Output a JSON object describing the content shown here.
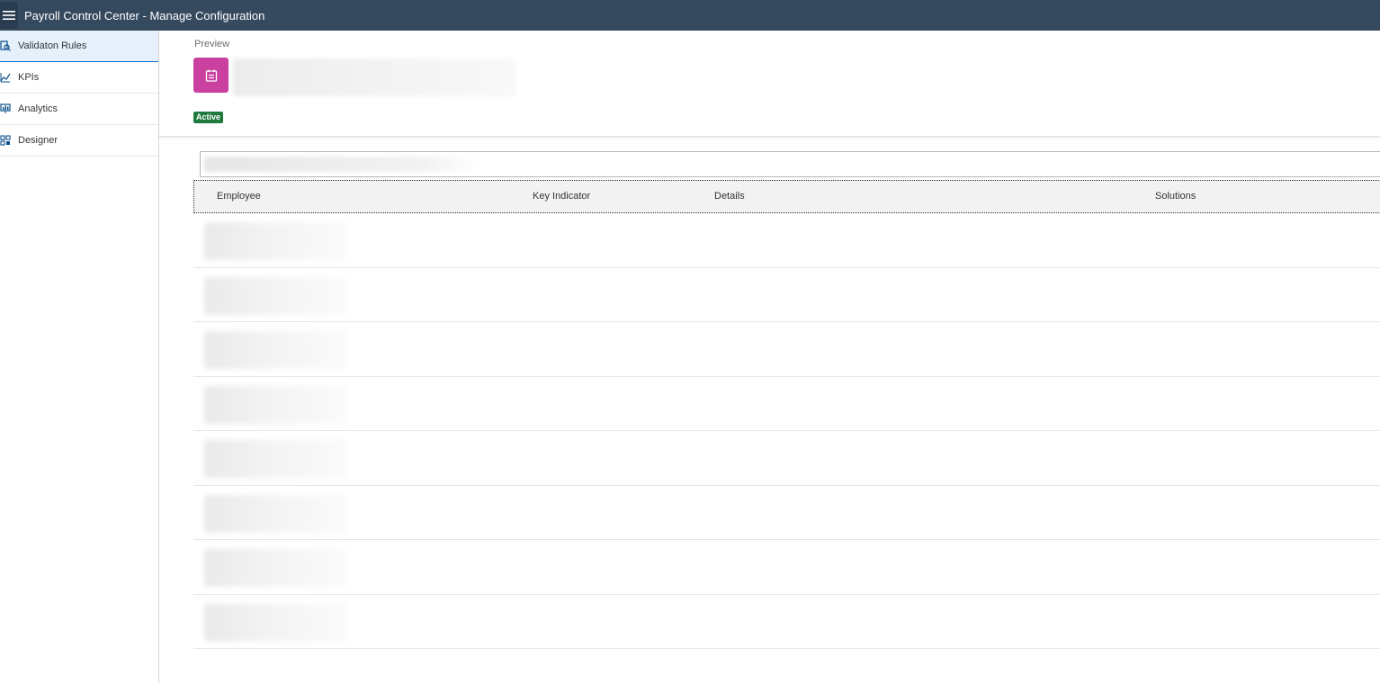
{
  "shell": {
    "title": "Payroll Control Center - Manage Configuration",
    "menu_icon": "hamburger-icon"
  },
  "sidebar": {
    "items": [
      {
        "label": "Validaton Rules",
        "icon": "validation-rules-icon",
        "selected": true
      },
      {
        "label": "KPIs",
        "icon": "kpi-chart-icon",
        "selected": false
      },
      {
        "label": "Analytics",
        "icon": "analytics-icon",
        "selected": false
      },
      {
        "label": "Designer",
        "icon": "designer-icon",
        "selected": false
      }
    ]
  },
  "header": {
    "preview_label": "Preview",
    "object_icon": "calendar-list-icon",
    "status": "Active"
  },
  "table": {
    "columns": [
      "Employee",
      "Key Indicator",
      "Details",
      "Solutions"
    ]
  },
  "colors": {
    "shell_bg": "#354a5f",
    "avatar_bg": "#c9409e",
    "status_bg": "#1f7a3e",
    "selected_bg": "#e5f0fa",
    "accent": "#0a6ed1"
  }
}
